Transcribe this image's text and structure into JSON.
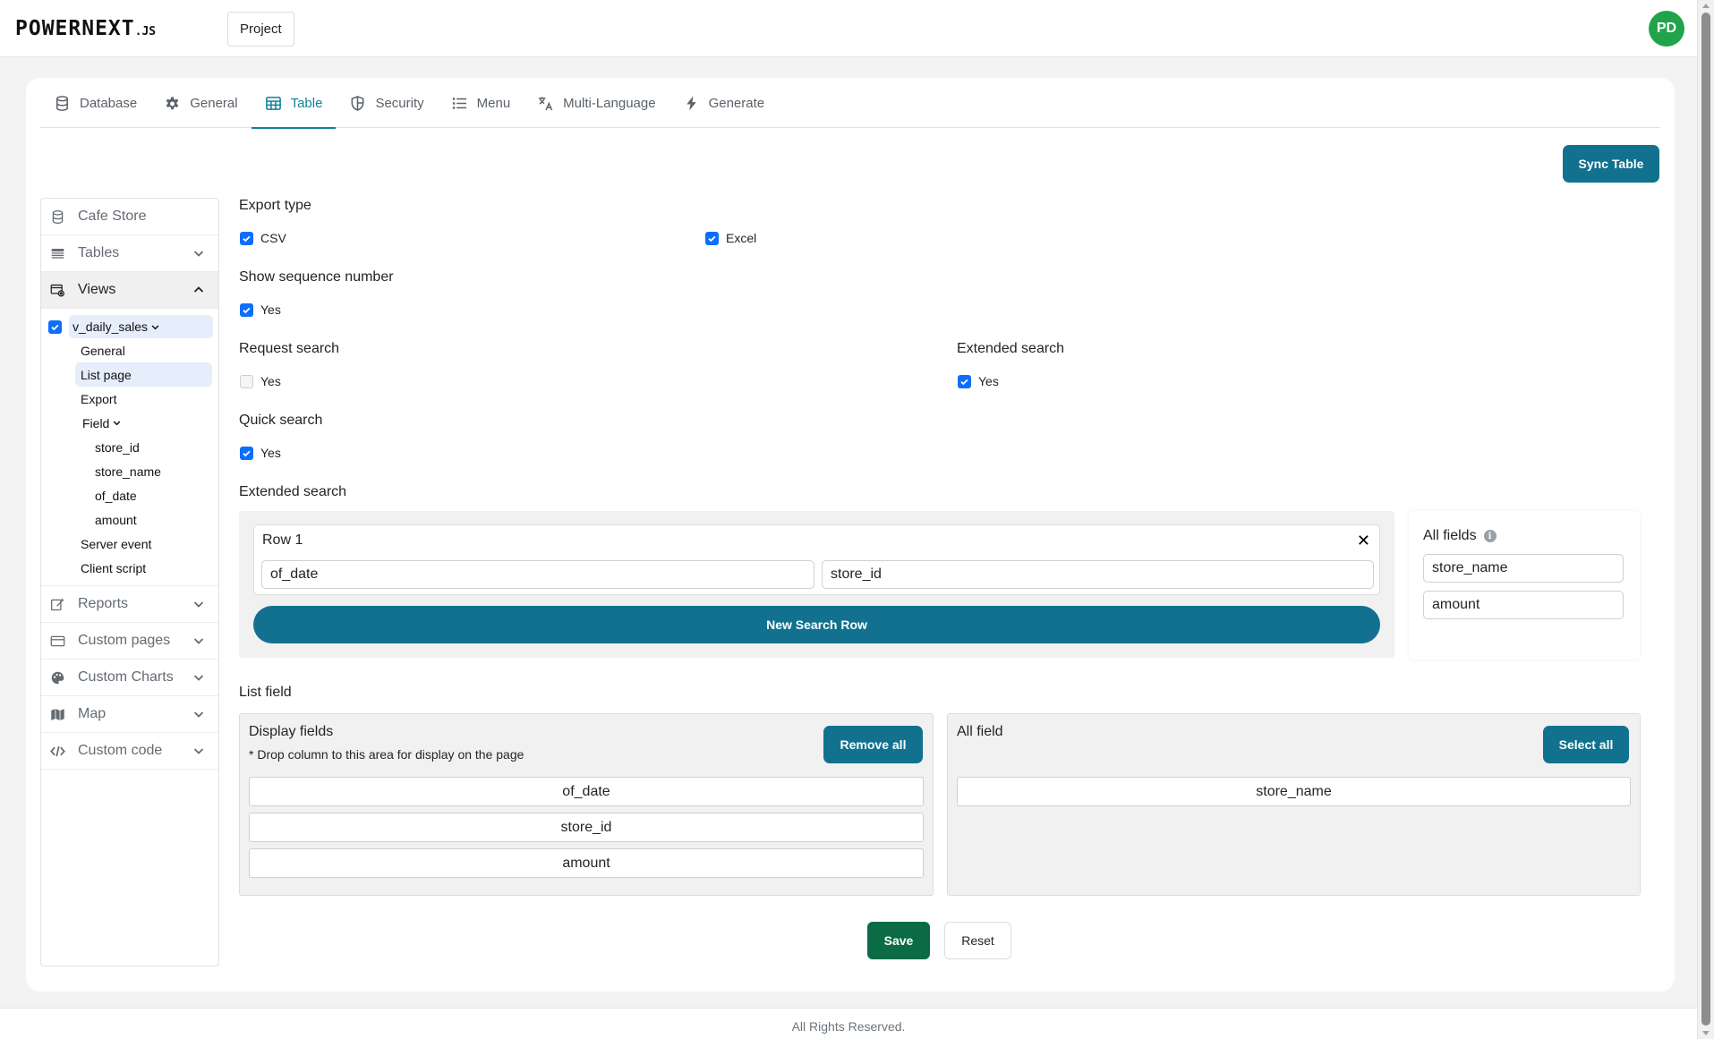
{
  "header": {
    "logo_text": "POWERNEXT",
    "logo_suffix": ".JS",
    "project_label": "Project",
    "avatar_initials": "PD"
  },
  "tabs": [
    {
      "label": "Database",
      "icon": "database-icon"
    },
    {
      "label": "General",
      "icon": "gear-icon"
    },
    {
      "label": "Table",
      "icon": "table-icon",
      "active": true
    },
    {
      "label": "Security",
      "icon": "shield-icon"
    },
    {
      "label": "Menu",
      "icon": "list-icon"
    },
    {
      "label": "Multi-Language",
      "icon": "translate-icon"
    },
    {
      "label": "Generate",
      "icon": "lightning-icon"
    }
  ],
  "sync_label": "Sync Table",
  "sidebar": {
    "project": "Cafe Store",
    "tables": "Tables",
    "views": "Views",
    "view_name": "v_daily_sales",
    "view_items": [
      "General",
      "List page",
      "Export"
    ],
    "field_label": "Field",
    "fields": [
      "store_id",
      "store_name",
      "of_date",
      "amount"
    ],
    "after_items": [
      "Server event",
      "Client script"
    ],
    "reports": "Reports",
    "custom_pages": "Custom pages",
    "custom_charts": "Custom Charts",
    "map": "Map",
    "custom_code": "Custom code"
  },
  "form": {
    "export_type": "Export type",
    "csv": "CSV",
    "excel": "Excel",
    "show_seq": "Show sequence number",
    "show_seq_yes": "Yes",
    "request_search": "Request search",
    "request_search_yes": "Yes",
    "extended_search_opt": "Extended search",
    "extended_search_yes": "Yes",
    "quick_search": "Quick search",
    "quick_search_yes": "Yes",
    "extended_search_section": "Extended search",
    "row_title": "Row 1",
    "row_field_1": "of_date",
    "row_field_2": "store_id",
    "new_row": "New Search Row",
    "all_fields_title": "All fields",
    "all_fields": [
      "store_name",
      "amount"
    ]
  },
  "list_field": {
    "title": "List field",
    "display_title": "Display fields",
    "display_hint": "* Drop column to this area for display on the page",
    "remove_all": "Remove all",
    "display_items": [
      "of_date",
      "store_id",
      "amount"
    ],
    "all_title": "All field",
    "select_all": "Select all",
    "all_items": [
      "store_name"
    ]
  },
  "actions": {
    "save": "Save",
    "reset": "Reset"
  },
  "footer": "All Rights Reserved.",
  "colors": {
    "accent": "#11718f",
    "save": "#0b6b45",
    "checkbox": "#0d6efd",
    "avatar": "#21a34c"
  }
}
